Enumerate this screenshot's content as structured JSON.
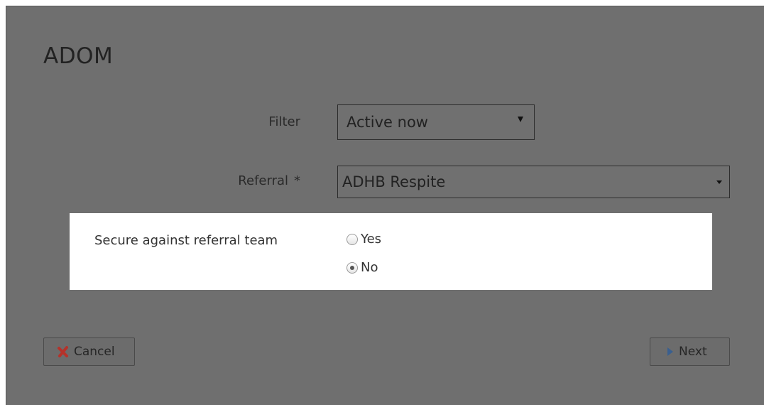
{
  "dialog": {
    "title": "ADOM"
  },
  "form": {
    "filter": {
      "label": "Filter",
      "value": "Active now"
    },
    "referral": {
      "label": "Referral",
      "required_marker": "*",
      "value": "ADHB Respite"
    },
    "secure": {
      "label": "Secure against referral team",
      "options": [
        {
          "label": "Yes",
          "checked": false
        },
        {
          "label": "No",
          "checked": true
        }
      ]
    }
  },
  "buttons": {
    "cancel_label": "Cancel",
    "next_label": "Next"
  },
  "colors": {
    "overlay": "#6f6f6f",
    "highlight": "#ffffff",
    "cancel_icon": "#c0392b",
    "next_icon": "#3b6ea8"
  }
}
